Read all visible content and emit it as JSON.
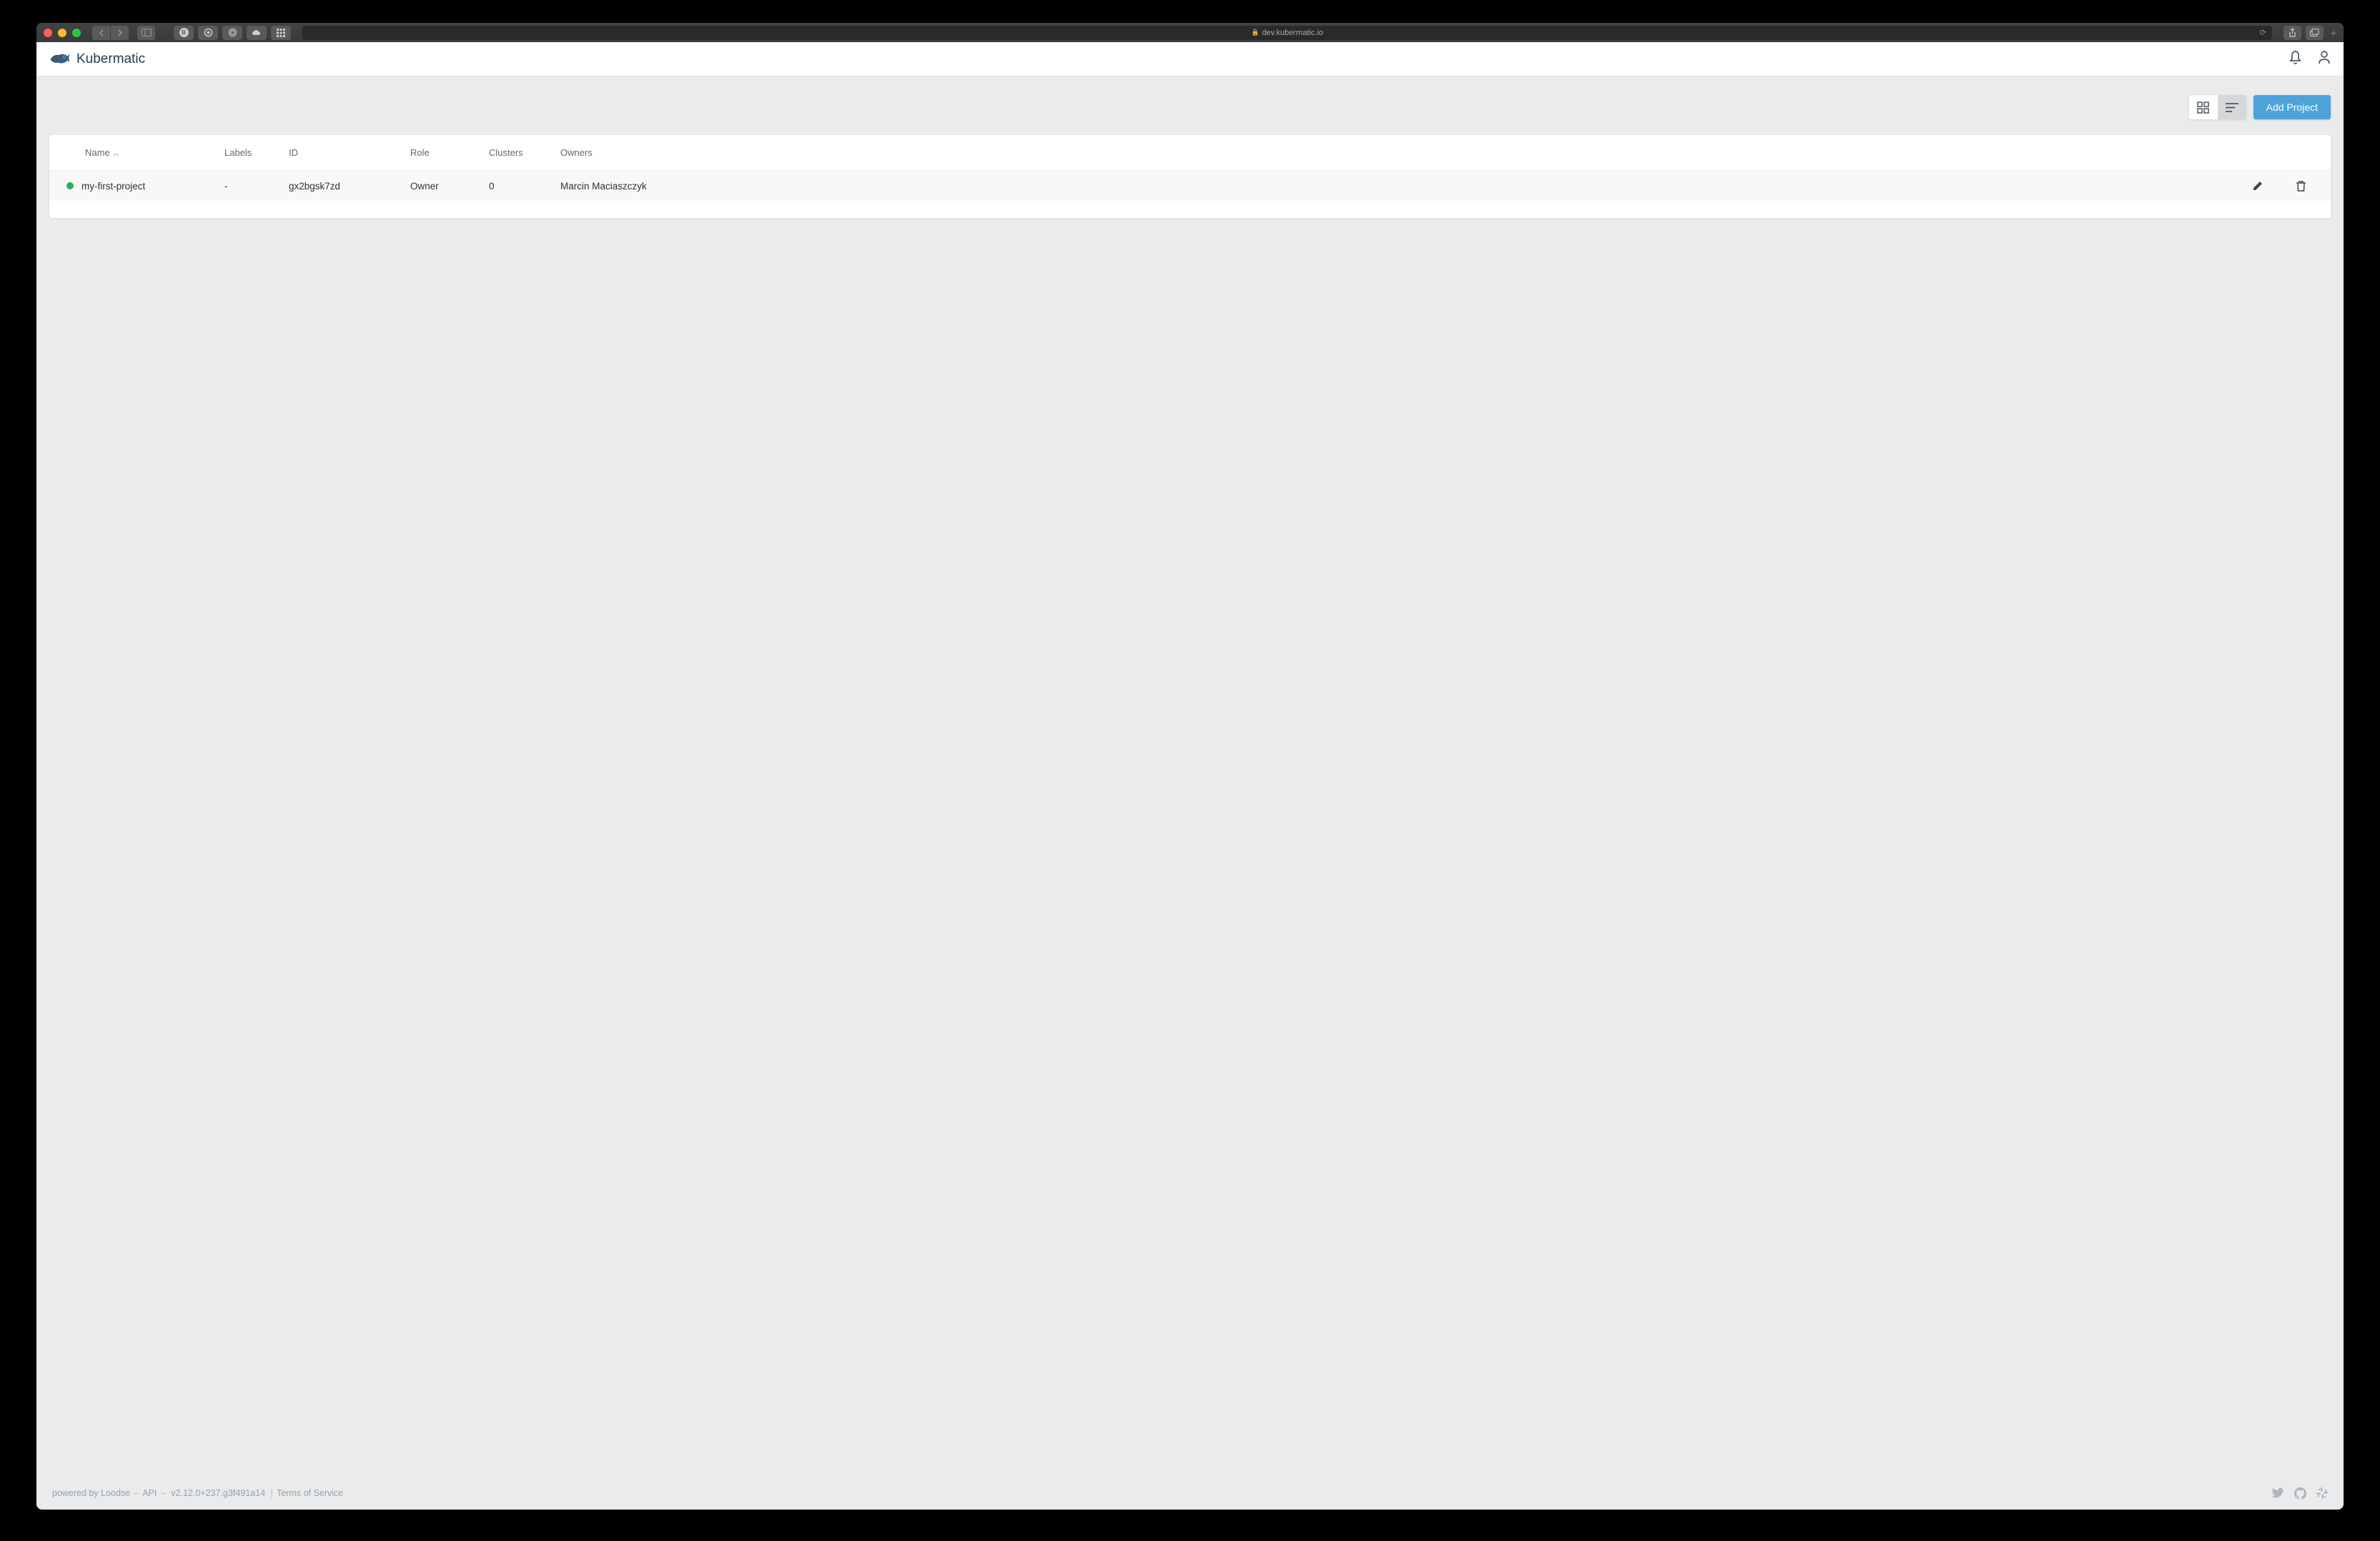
{
  "browser": {
    "url": "dev.kubermatic.io"
  },
  "header": {
    "brand_name": "Kubermatic"
  },
  "toolbar": {
    "add_project_label": "Add Project"
  },
  "table": {
    "columns": {
      "name": "Name",
      "labels": "Labels",
      "id": "ID",
      "role": "Role",
      "clusters": "Clusters",
      "owners": "Owners"
    },
    "rows": [
      {
        "status": "green",
        "name": "my-first-project",
        "labels": "-",
        "id": "gx2bgsk7zd",
        "role": "Owner",
        "clusters": "0",
        "owners": "Marcin Maciaszczyk"
      }
    ]
  },
  "footer": {
    "powered_by": "powered by Loodse",
    "api": "API",
    "version": "v2.12.0+237.g3f491a14",
    "tos": "Terms of Service"
  }
}
